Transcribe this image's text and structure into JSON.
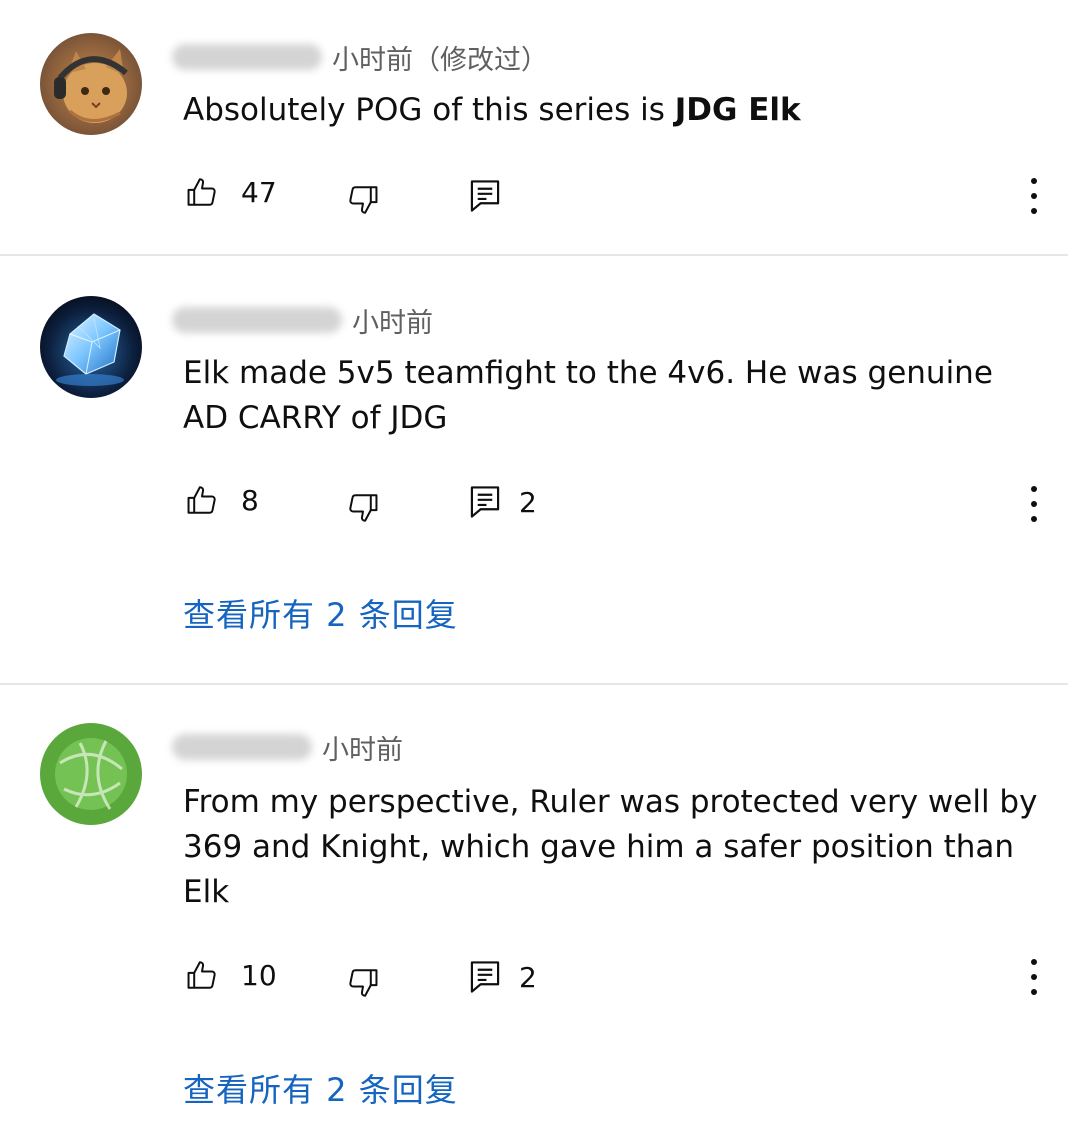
{
  "comments": [
    {
      "time": "小时前（修改过）",
      "text_plain": "Absolutely POG of this series is ",
      "text_bold": "JDG Elk",
      "likes": "47",
      "reply_count": "",
      "view_replies": ""
    },
    {
      "time": "小时前",
      "text": "Elk made 5v5 teamfight to the 4v6. He was genuine AD CARRY of JDG",
      "likes": "8",
      "reply_count": "2",
      "view_replies": "查看所有 2 条回复"
    },
    {
      "time": "小时前",
      "text": "From my perspective, Ruler was protected very well by 369 and Knight, which gave him a safer position than Elk",
      "likes": "10",
      "reply_count": "2",
      "view_replies": "查看所有 2 条回复"
    }
  ],
  "icons": {
    "like": "thumbs-up-icon",
    "dislike": "thumbs-down-icon",
    "reply": "reply-icon",
    "more": "more-vertical-icon"
  },
  "colors": {
    "link": "#1565c0",
    "secondary_text": "#606060",
    "divider": "#e6e6e6"
  }
}
